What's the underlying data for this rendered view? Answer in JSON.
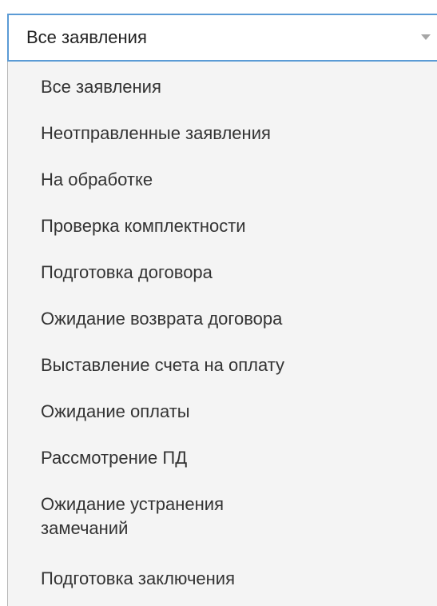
{
  "select": {
    "value": "Все заявления"
  },
  "options": [
    "Все заявления",
    "Неотправленные заявления",
    "На обработке",
    "Проверка комплектности",
    "Подготовка договора",
    "Ожидание возврата договора",
    "Выставление счета на оплату",
    "Ожидание оплаты",
    "Рассмотрение ПД",
    "Ожидание устранения замечаний",
    "Подготовка заключения"
  ]
}
